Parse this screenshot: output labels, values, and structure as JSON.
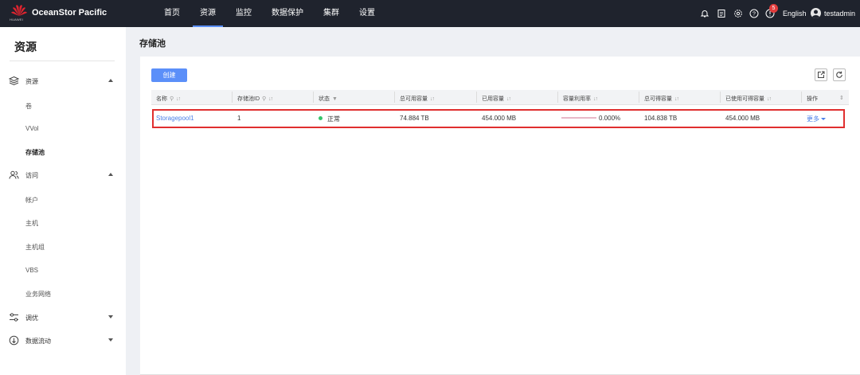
{
  "header": {
    "brand_sub": "HUAWEI",
    "app_title": "OceanStor Pacific",
    "nav": [
      "首页",
      "资源",
      "监控",
      "数据保护",
      "集群",
      "设置"
    ],
    "active_nav": "资源",
    "notification_count": "5",
    "language": "English",
    "username": "testadmin"
  },
  "sidebar": {
    "title": "资源",
    "groups": [
      {
        "label": "资源",
        "icon": "layers-icon",
        "expanded": true,
        "items": [
          "卷",
          "VVol",
          "存储池"
        ]
      },
      {
        "label": "访问",
        "icon": "users-icon",
        "expanded": true,
        "items": [
          "帐户",
          "主机",
          "主机组",
          "VBS",
          "业务网络"
        ]
      },
      {
        "label": "调优",
        "icon": "sliders-icon",
        "expanded": false,
        "items": []
      },
      {
        "label": "数据流动",
        "icon": "data-flow-icon",
        "expanded": false,
        "items": []
      }
    ],
    "active_item": "存储池"
  },
  "main": {
    "page_title": "存储池",
    "create_label": "创建",
    "columns": [
      "名称",
      "存储池ID",
      "状态",
      "总可用容量",
      "已用容量",
      "容量利用率",
      "总可得容量",
      "已使用可得容量",
      "操作"
    ],
    "rows": [
      {
        "name": "Storagepool1",
        "id": "1",
        "status": "正常",
        "total_available": "74.884 TB",
        "used": "454.000 MB",
        "utilization": "0.000%",
        "utilization_value": 0.0,
        "total_obtainable": "104.838 TB",
        "used_obtainable": "454.000 MB",
        "action": "更多"
      }
    ]
  },
  "colors": {
    "topbar": "#1f232d",
    "accent": "#5b8ff9",
    "link": "#4a7fe8",
    "highlight_border": "#e02f2f",
    "status_ok": "#35c46b",
    "badge": "#e23c3c"
  }
}
